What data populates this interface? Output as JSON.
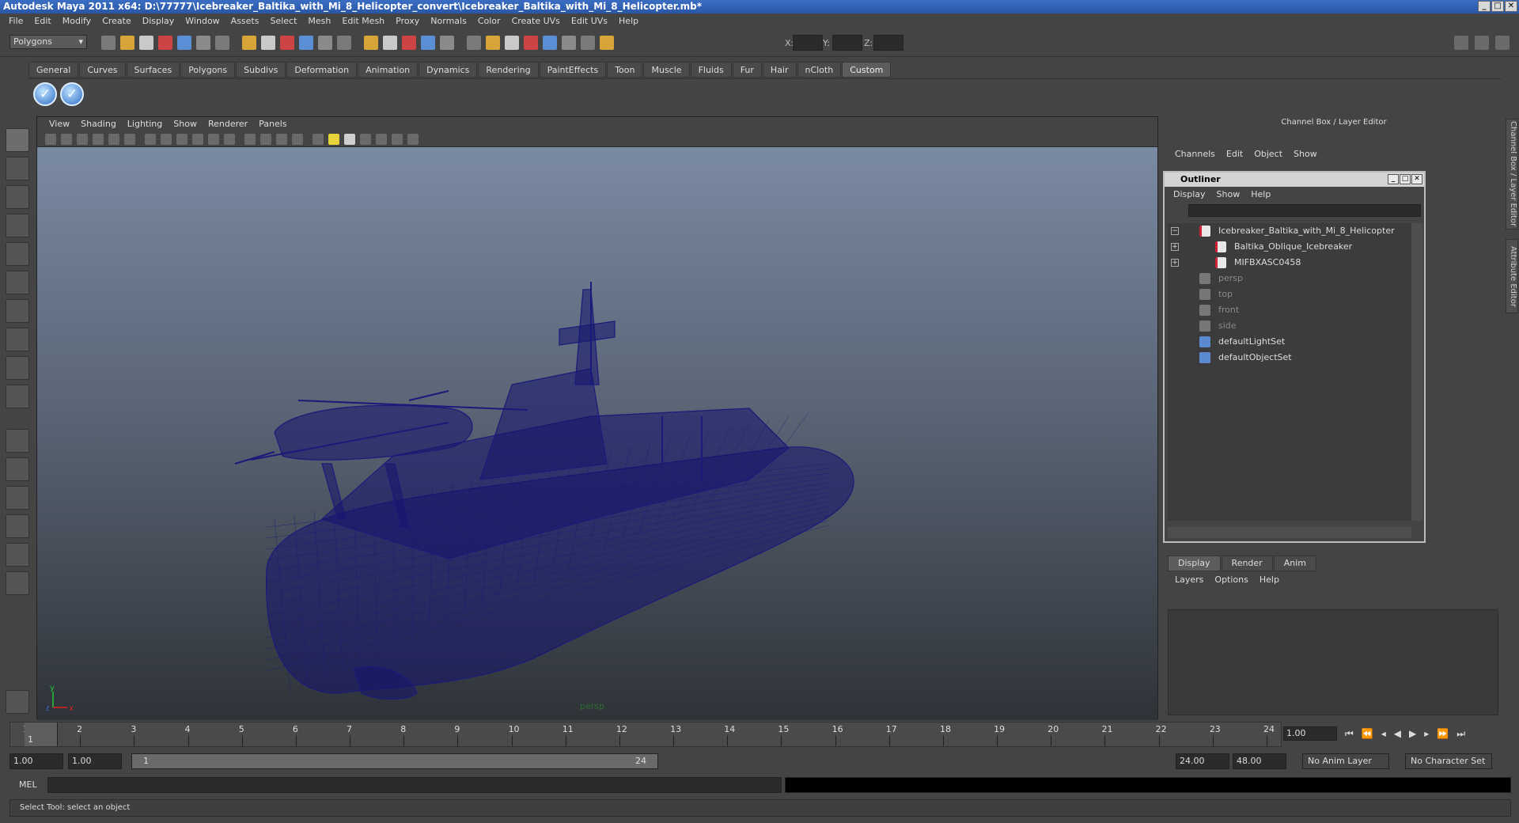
{
  "window": {
    "title": "Autodesk Maya 2011 x64: D:\\77777\\Icebreaker_Baltika_with_Mi_8_Helicopter_convert\\Icebreaker_Baltika_with_Mi_8_Helicopter.mb*"
  },
  "menubar": [
    "File",
    "Edit",
    "Modify",
    "Create",
    "Display",
    "Window",
    "Assets",
    "Select",
    "Mesh",
    "Edit Mesh",
    "Proxy",
    "Normals",
    "Color",
    "Create UVs",
    "Edit UVs",
    "Help"
  ],
  "statusline": {
    "mode": "Polygons",
    "x_label": "X:",
    "y_label": "Y:",
    "z_label": "Z:"
  },
  "shelf": {
    "tabs": [
      "General",
      "Curves",
      "Surfaces",
      "Polygons",
      "Subdivs",
      "Deformation",
      "Animation",
      "Dynamics",
      "Rendering",
      "PaintEffects",
      "Toon",
      "Muscle",
      "Fluids",
      "Fur",
      "Hair",
      "nCloth",
      "Custom"
    ],
    "active": "Custom"
  },
  "viewport": {
    "menus": [
      "View",
      "Shading",
      "Lighting",
      "Show",
      "Renderer",
      "Panels"
    ],
    "camera": "persp",
    "axis_y": "y",
    "axis_x": "x",
    "axis_z": "z",
    "wire_color": "#1a1a7a"
  },
  "channelbox": {
    "title": "Channel Box / Layer Editor",
    "menus": [
      "Channels",
      "Edit",
      "Object",
      "Show"
    ]
  },
  "outliner": {
    "title": "Outliner",
    "menus": [
      "Display",
      "Show",
      "Help"
    ],
    "items": [
      {
        "label": "Icebreaker_Baltika_with_Mi_8_Helicopter",
        "icon": "transform-icon",
        "expand": "−",
        "dim": false
      },
      {
        "label": "Baltika_Oblique_Icebreaker",
        "icon": "transform-icon",
        "expand": "+",
        "dim": false
      },
      {
        "label": "MIFBXASC0458",
        "icon": "transform-icon",
        "expand": "+",
        "dim": false
      },
      {
        "label": "persp",
        "icon": "camera-icon",
        "expand": "",
        "dim": true
      },
      {
        "label": "top",
        "icon": "camera-icon",
        "expand": "",
        "dim": true
      },
      {
        "label": "front",
        "icon": "camera-icon",
        "expand": "",
        "dim": true
      },
      {
        "label": "side",
        "icon": "camera-icon",
        "expand": "",
        "dim": true
      },
      {
        "label": "defaultLightSet",
        "icon": "set-icon",
        "expand": "",
        "dim": false
      },
      {
        "label": "defaultObjectSet",
        "icon": "set-icon",
        "expand": "",
        "dim": false
      }
    ]
  },
  "layer_editor": {
    "tabs": [
      "Display",
      "Render",
      "Anim"
    ],
    "active": "Display",
    "menus": [
      "Layers",
      "Options",
      "Help"
    ]
  },
  "timeline": {
    "ticks": [
      "1",
      "2",
      "3",
      "4",
      "5",
      "6",
      "7",
      "8",
      "9",
      "10",
      "11",
      "12",
      "13",
      "14",
      "15",
      "16",
      "17",
      "18",
      "19",
      "20",
      "21",
      "22",
      "23",
      "24"
    ],
    "current_marker": "1",
    "current_frame": "1.00"
  },
  "range": {
    "start": "1.00",
    "inner_start": "1.00",
    "slider_start": "1",
    "slider_end": "24",
    "end": "24.00",
    "outer_end": "48.00",
    "anim_layer": "No Anim Layer",
    "character_set": "No Character Set"
  },
  "mel": {
    "label": "MEL"
  },
  "helpline": {
    "text": "Select Tool: select an object"
  },
  "sidetabs": [
    "Channel Box / Layer Editor",
    "Attribute Editor"
  ]
}
